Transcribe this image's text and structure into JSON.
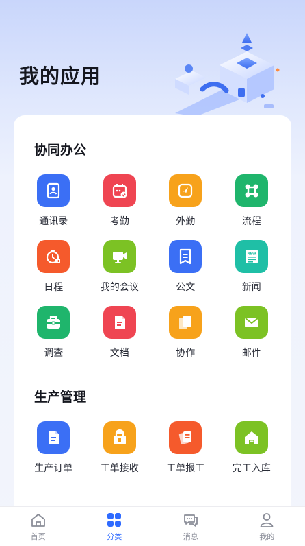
{
  "header": {
    "title": "我的应用"
  },
  "sections": [
    {
      "title": "协同办公",
      "apps": [
        {
          "label": "通讯录",
          "icon": "contacts-icon",
          "color": "#3b6ff5"
        },
        {
          "label": "考勤",
          "icon": "calendar-check-icon",
          "color": "#ef4552"
        },
        {
          "label": "外勤",
          "icon": "location-arrow-icon",
          "color": "#f7a21b"
        },
        {
          "label": "流程",
          "icon": "flow-icon",
          "color": "#1fb56c"
        },
        {
          "label": "日程",
          "icon": "schedule-clock-icon",
          "color": "#f55a2c"
        },
        {
          "label": "我的会议",
          "icon": "meeting-icon",
          "color": "#7cc224"
        },
        {
          "label": "公文",
          "icon": "document-icon",
          "color": "#3b6ff5"
        },
        {
          "label": "新闻",
          "icon": "news-icon",
          "color": "#1fbfa6"
        },
        {
          "label": "调查",
          "icon": "briefcase-icon",
          "color": "#1fb56c"
        },
        {
          "label": "文档",
          "icon": "file-icon",
          "color": "#ef4552"
        },
        {
          "label": "协作",
          "icon": "collaborate-icon",
          "color": "#f7a21b"
        },
        {
          "label": "邮件",
          "icon": "mail-icon",
          "color": "#7cc224"
        }
      ]
    },
    {
      "title": "生产管理",
      "apps": [
        {
          "label": "生产订单",
          "icon": "order-icon",
          "color": "#3b6ff5"
        },
        {
          "label": "工单接收",
          "icon": "receive-icon",
          "color": "#f7a21b"
        },
        {
          "label": "工单报工",
          "icon": "report-icon",
          "color": "#f55a2c"
        },
        {
          "label": "完工入库",
          "icon": "warehouse-icon",
          "color": "#7cc224"
        }
      ]
    }
  ],
  "tabbar": {
    "items": [
      {
        "label": "首页",
        "icon": "home-icon"
      },
      {
        "label": "分类",
        "icon": "category-icon",
        "active": true
      },
      {
        "label": "消息",
        "icon": "message-icon"
      },
      {
        "label": "我的",
        "icon": "user-icon"
      }
    ],
    "active_color": "#2f6bff",
    "inactive_color": "#8a8d98"
  }
}
